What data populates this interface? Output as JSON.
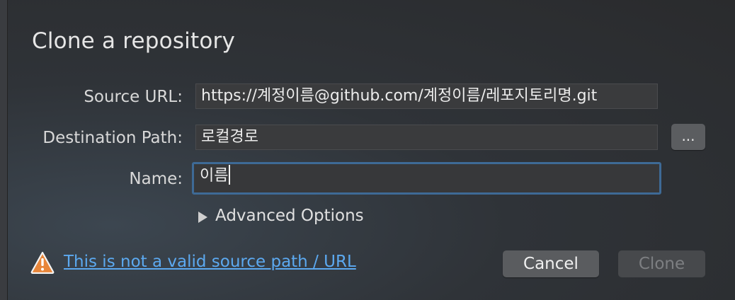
{
  "dialog": {
    "title": "Clone a repository"
  },
  "form": {
    "source_url_label": "Source URL:",
    "source_url_value": "https://계정이름@github.com/계정이름/레포지토리명.git",
    "destination_label": "Destination Path:",
    "destination_value": "로컬경로",
    "browse_label": "...",
    "name_label": "Name:",
    "name_value": "이름"
  },
  "advanced": {
    "label": "Advanced Options"
  },
  "warning": {
    "icon": "warning-triangle-icon",
    "message": "This is not a valid source path / URL",
    "color": "#e8863a"
  },
  "buttons": {
    "cancel_label": "Cancel",
    "clone_label": "Clone"
  },
  "colors": {
    "link": "#5ca9f0",
    "focus_ring": "#3e6a96"
  }
}
